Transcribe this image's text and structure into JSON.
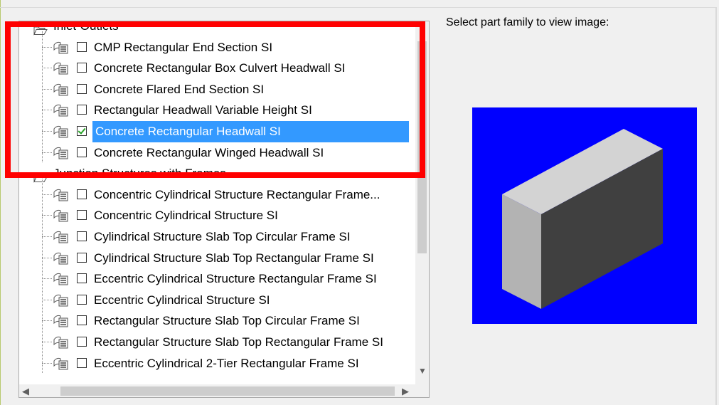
{
  "preview": {
    "label": "Select part family to view image:",
    "background_color": "#0000ff"
  },
  "tree": {
    "groups": [
      {
        "label": "Inlet-Outlets",
        "icon": "open-folder-icon",
        "items": [
          {
            "label": "CMP Rectangular End Section SI",
            "checked": false,
            "selected": false
          },
          {
            "label": "Concrete Rectangular Box Culvert Headwall SI",
            "checked": false,
            "selected": false
          },
          {
            "label": "Concrete Flared End Section SI",
            "checked": false,
            "selected": false
          },
          {
            "label": "Rectangular Headwall Variable Height SI",
            "checked": false,
            "selected": false
          },
          {
            "label": "Concrete Rectangular Headwall SI",
            "checked": true,
            "selected": true
          },
          {
            "label": "Concrete Rectangular Winged Headwall SI",
            "checked": false,
            "selected": false
          }
        ]
      },
      {
        "label": "Junction Structures with Frames",
        "icon": "open-folder-icon",
        "items": [
          {
            "label": "Concentric Cylindrical Structure Rectangular Frame...",
            "checked": false,
            "selected": false
          },
          {
            "label": "Concentric Cylindrical Structure SI",
            "checked": false,
            "selected": false
          },
          {
            "label": "Cylindrical Structure Slab Top Circular Frame SI",
            "checked": false,
            "selected": false
          },
          {
            "label": "Cylindrical Structure Slab Top Rectangular Frame SI",
            "checked": false,
            "selected": false
          },
          {
            "label": "Eccentric Cylindrical Structure Rectangular Frame SI",
            "checked": false,
            "selected": false
          },
          {
            "label": "Eccentric Cylindrical Structure SI",
            "checked": false,
            "selected": false
          },
          {
            "label": "Rectangular Structure Slab Top Circular Frame SI",
            "checked": false,
            "selected": false
          },
          {
            "label": "Rectangular Structure Slab Top Rectangular Frame SI",
            "checked": false,
            "selected": false
          },
          {
            "label": "Eccentric Cylindrical 2-Tier Rectangular Frame SI",
            "checked": false,
            "selected": false
          }
        ]
      }
    ]
  },
  "scrollbars": {
    "vertical": {
      "up_arrow": "▲",
      "down_arrow": "▼"
    },
    "horizontal": {
      "left_arrow": "◀",
      "right_arrow": "▶"
    }
  },
  "annotation": {
    "highlight_color": "#ff0000"
  },
  "colors": {
    "selection": "#3399ff",
    "check": "#27a327"
  }
}
